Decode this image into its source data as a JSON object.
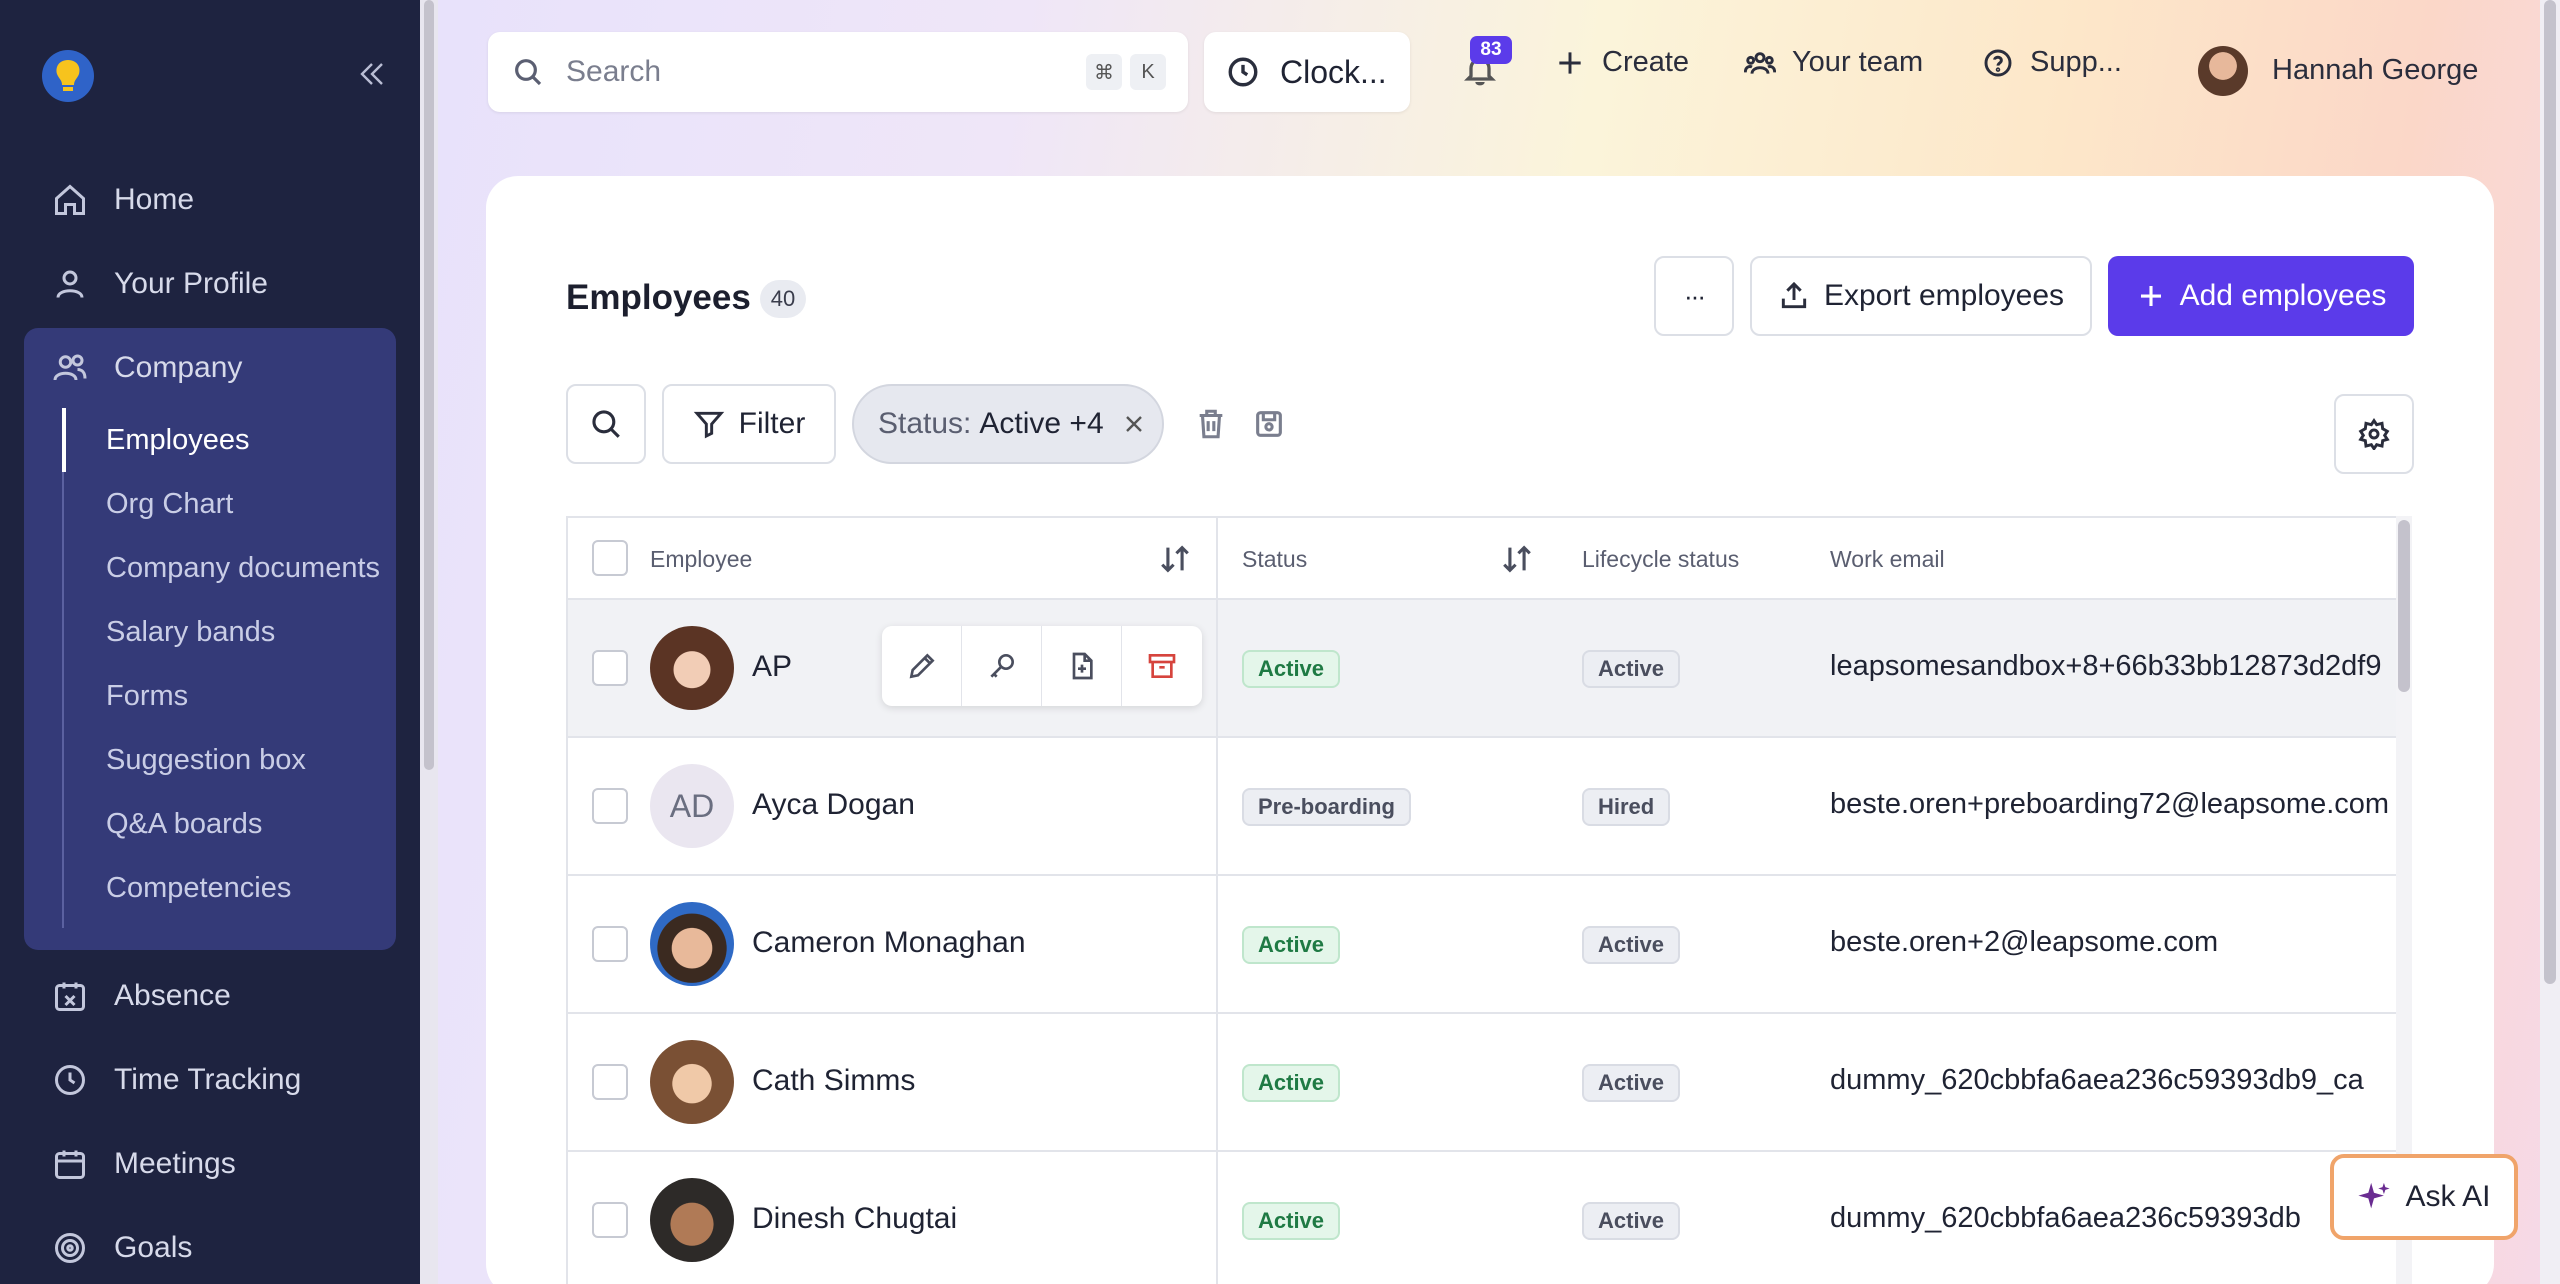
{
  "sidebar": {
    "nav": [
      {
        "label": "Home",
        "icon": "home-icon"
      },
      {
        "label": "Your Profile",
        "icon": "user-icon"
      },
      {
        "label": "Company",
        "icon": "users-icon"
      },
      {
        "label": "Absence",
        "icon": "calendar-x-icon"
      },
      {
        "label": "Time Tracking",
        "icon": "clock-icon"
      },
      {
        "label": "Meetings",
        "icon": "calendar-icon"
      },
      {
        "label": "Goals",
        "icon": "target-icon"
      }
    ],
    "company_sub": [
      "Employees",
      "Org Chart",
      "Company documents",
      "Salary bands",
      "Forms",
      "Suggestion box",
      "Q&A boards",
      "Competencies"
    ]
  },
  "topbar": {
    "search_placeholder": "Search",
    "kbd_1": "⌘",
    "kbd_2": "K",
    "clock_label": "Clock...",
    "notifications_count": "83",
    "create_label": "Create",
    "team_label": "Your team",
    "support_label": "Supp...",
    "user_name": "Hannah George"
  },
  "page": {
    "title": "Employees",
    "count": "40",
    "more_label": "···",
    "export_label": "Export employees",
    "add_label": "Add employees",
    "filter_label": "Filter",
    "chip_key": "Status:",
    "chip_value": "Active +4"
  },
  "table": {
    "headers": {
      "employee": "Employee",
      "status": "Status",
      "lifecycle": "Lifecycle status",
      "email": "Work email"
    },
    "rows": [
      {
        "initials": "",
        "name": "AP",
        "status": "Active",
        "lifecycle": "Active",
        "email": "leapsomesandbox+8+66b33bb12873d2df9"
      },
      {
        "initials": "AD",
        "name": "Ayca Dogan",
        "status": "Pre-boarding",
        "lifecycle": "Hired",
        "email": "beste.oren+preboarding72@leapsome.com"
      },
      {
        "initials": "",
        "name": "Cameron Monaghan",
        "status": "Active",
        "lifecycle": "Active",
        "email": "beste.oren+2@leapsome.com"
      },
      {
        "initials": "",
        "name": "Cath Simms",
        "status": "Active",
        "lifecycle": "Active",
        "email": "dummy_620cbbfa6aea236c59393db9_ca"
      },
      {
        "initials": "",
        "name": "Dinesh Chugtai",
        "status": "Active",
        "lifecycle": "Active",
        "email": "dummy_620cbbfa6aea236c59393db"
      }
    ]
  },
  "ask_ai": "Ask AI",
  "colors": {
    "sidebar": "#1e2340",
    "accent": "#5b3bea",
    "active_green": "#1f7a44"
  }
}
